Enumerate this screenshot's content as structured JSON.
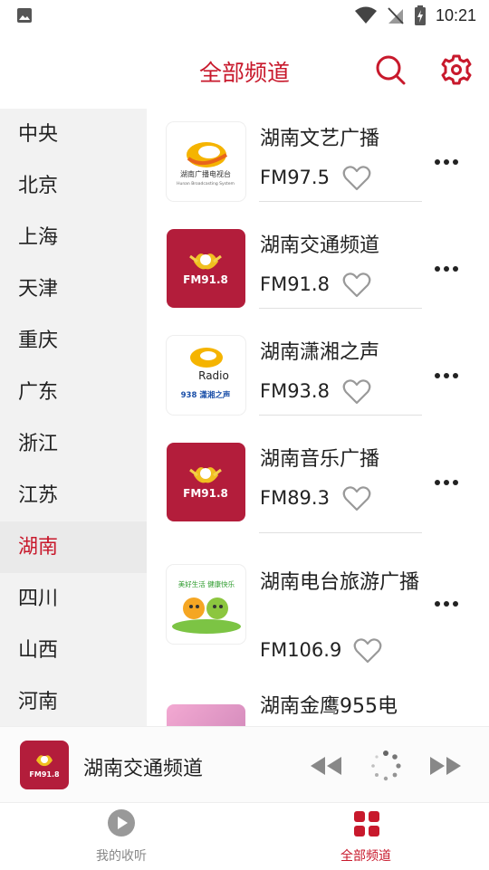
{
  "status_bar": {
    "time": "10:21"
  },
  "header": {
    "title": "全部频道"
  },
  "sidebar": {
    "items": [
      {
        "label": "中央"
      },
      {
        "label": "北京"
      },
      {
        "label": "上海"
      },
      {
        "label": "天津"
      },
      {
        "label": "重庆"
      },
      {
        "label": "广东"
      },
      {
        "label": "浙江"
      },
      {
        "label": "江苏"
      },
      {
        "label": "湖南",
        "selected": true
      },
      {
        "label": "四川"
      },
      {
        "label": "山西"
      },
      {
        "label": "河南"
      }
    ]
  },
  "stations": [
    {
      "name": "湖南文艺广播",
      "freq": "FM97.5",
      "logo_text": "湖南广播电视台",
      "logo_sub": "Hunan Broadcasting System"
    },
    {
      "name": "湖南交通频道",
      "freq": "FM91.8",
      "logo_text": "FM91.8"
    },
    {
      "name": "湖南潇湘之声",
      "freq": "FM93.8",
      "logo_text": "Radio",
      "logo_sub": "938 潇湘之声"
    },
    {
      "name": "湖南音乐广播",
      "freq": "FM89.3",
      "logo_text": "FM91.8"
    },
    {
      "name": "湖南电台旅游广播",
      "freq": "FM106.9",
      "logo_text": "美好生活 健康快乐"
    },
    {
      "name": "湖南金鹰955电",
      "freq": ""
    }
  ],
  "player": {
    "now_playing": "湖南交通频道",
    "logo_text": "FM91.8"
  },
  "bottom_nav": {
    "tabs": [
      {
        "label": "我的收听"
      },
      {
        "label": "全部频道",
        "active": true
      }
    ]
  },
  "colors": {
    "accent": "#c8192c",
    "logo_red": "#b31d3b"
  }
}
